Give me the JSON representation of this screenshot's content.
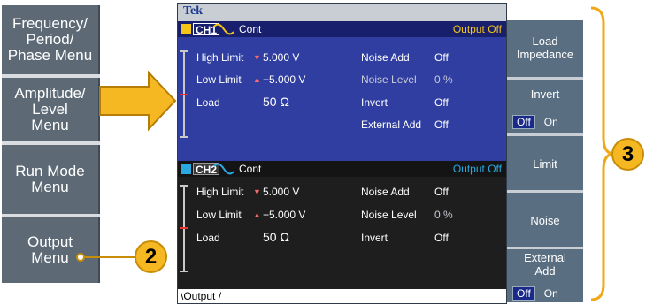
{
  "left_buttons": [
    {
      "label": "Frequency/\nPeriod/\nPhase Menu"
    },
    {
      "label": "Amplitude/\nLevel\nMenu"
    },
    {
      "label": "Run Mode\nMenu"
    },
    {
      "label": "Output\nMenu"
    }
  ],
  "screen": {
    "brand": "Tek",
    "channels": [
      {
        "id": "CH1",
        "mode": "Cont",
        "output_status": "Output Off",
        "rows": [
          {
            "name": "High Limit",
            "marker": "▼",
            "value": "5.000 V",
            "param": "Noise Add",
            "param_value": "Off"
          },
          {
            "name": "Low Limit",
            "marker": "▲",
            "value": "−5.000 V",
            "param": "Noise Level",
            "param_value": "0 %"
          },
          {
            "name": "Load",
            "marker": "",
            "value": "50 Ω",
            "param": "Invert",
            "param_value": "Off"
          },
          {
            "name": "",
            "marker": "",
            "value": "",
            "param": "External Add",
            "param_value": "Off"
          }
        ]
      },
      {
        "id": "CH2",
        "mode": "Cont",
        "output_status": "Output Off",
        "rows": [
          {
            "name": "High Limit",
            "marker": "▼",
            "value": "5.000 V",
            "param": "Noise Add",
            "param_value": "Off"
          },
          {
            "name": "Low Limit",
            "marker": "▲",
            "value": "−5.000 V",
            "param": "Noise Level",
            "param_value": "0 %"
          },
          {
            "name": "Load",
            "marker": "",
            "value": "50 Ω",
            "param": "Invert",
            "param_value": "Off"
          }
        ]
      }
    ],
    "bottom_tab": "Output"
  },
  "soft_keys": [
    {
      "label": "Load\nImpedance"
    },
    {
      "label": "Invert",
      "off": "Off",
      "on": "On"
    },
    {
      "label": "Limit"
    },
    {
      "label": "Noise"
    },
    {
      "label": "External\nAdd",
      "off": "Off",
      "on": "On"
    }
  ],
  "callouts": {
    "two": "2",
    "three": "3"
  },
  "colors": {
    "arrow": "#f5b722",
    "ch1": "#f5c518",
    "ch2": "#2aa8e0",
    "bracket": "#f0a818"
  }
}
